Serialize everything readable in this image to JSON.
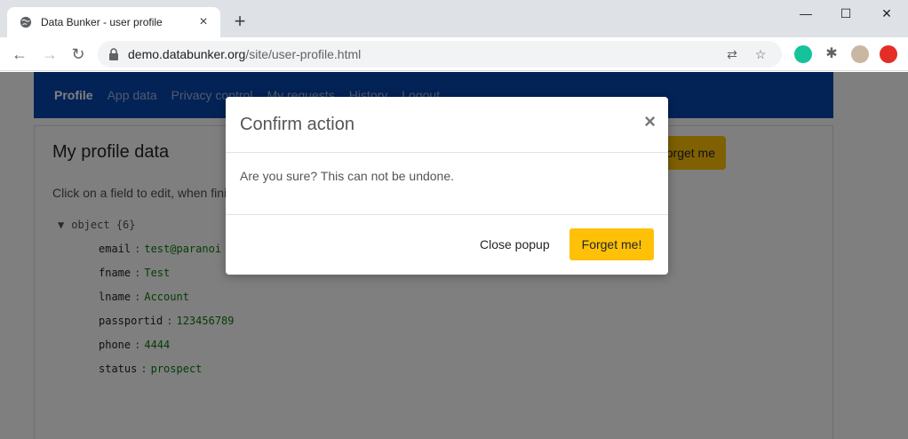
{
  "browser": {
    "tab_title": "Data Bunker - user profile",
    "url_host": "demo.databunker.org",
    "url_path": "/site/user-profile.html"
  },
  "navbar": {
    "items": [
      "Profile",
      "App data",
      "Privacy control",
      "My requests",
      "History",
      "Logout"
    ]
  },
  "profile": {
    "title": "My profile data",
    "forget_button": "Forget me",
    "hint": "Click on a field to edit, when finished",
    "object_label": "object",
    "object_count": "{6}",
    "fields": [
      {
        "key": "email",
        "value": "test@paranoi"
      },
      {
        "key": "fname",
        "value": "Test"
      },
      {
        "key": "lname",
        "value": "Account"
      },
      {
        "key": "passportid",
        "value": "123456789"
      },
      {
        "key": "phone",
        "value": "4444"
      },
      {
        "key": "status",
        "value": "prospect"
      }
    ]
  },
  "modal": {
    "title": "Confirm action",
    "close_glyph": "×",
    "body": "Are you sure? This can not be undone.",
    "close_button": "Close popup",
    "confirm_button": "Forget me!"
  },
  "colors": {
    "navbar": "#0645ad",
    "accent": "#ffc107"
  }
}
